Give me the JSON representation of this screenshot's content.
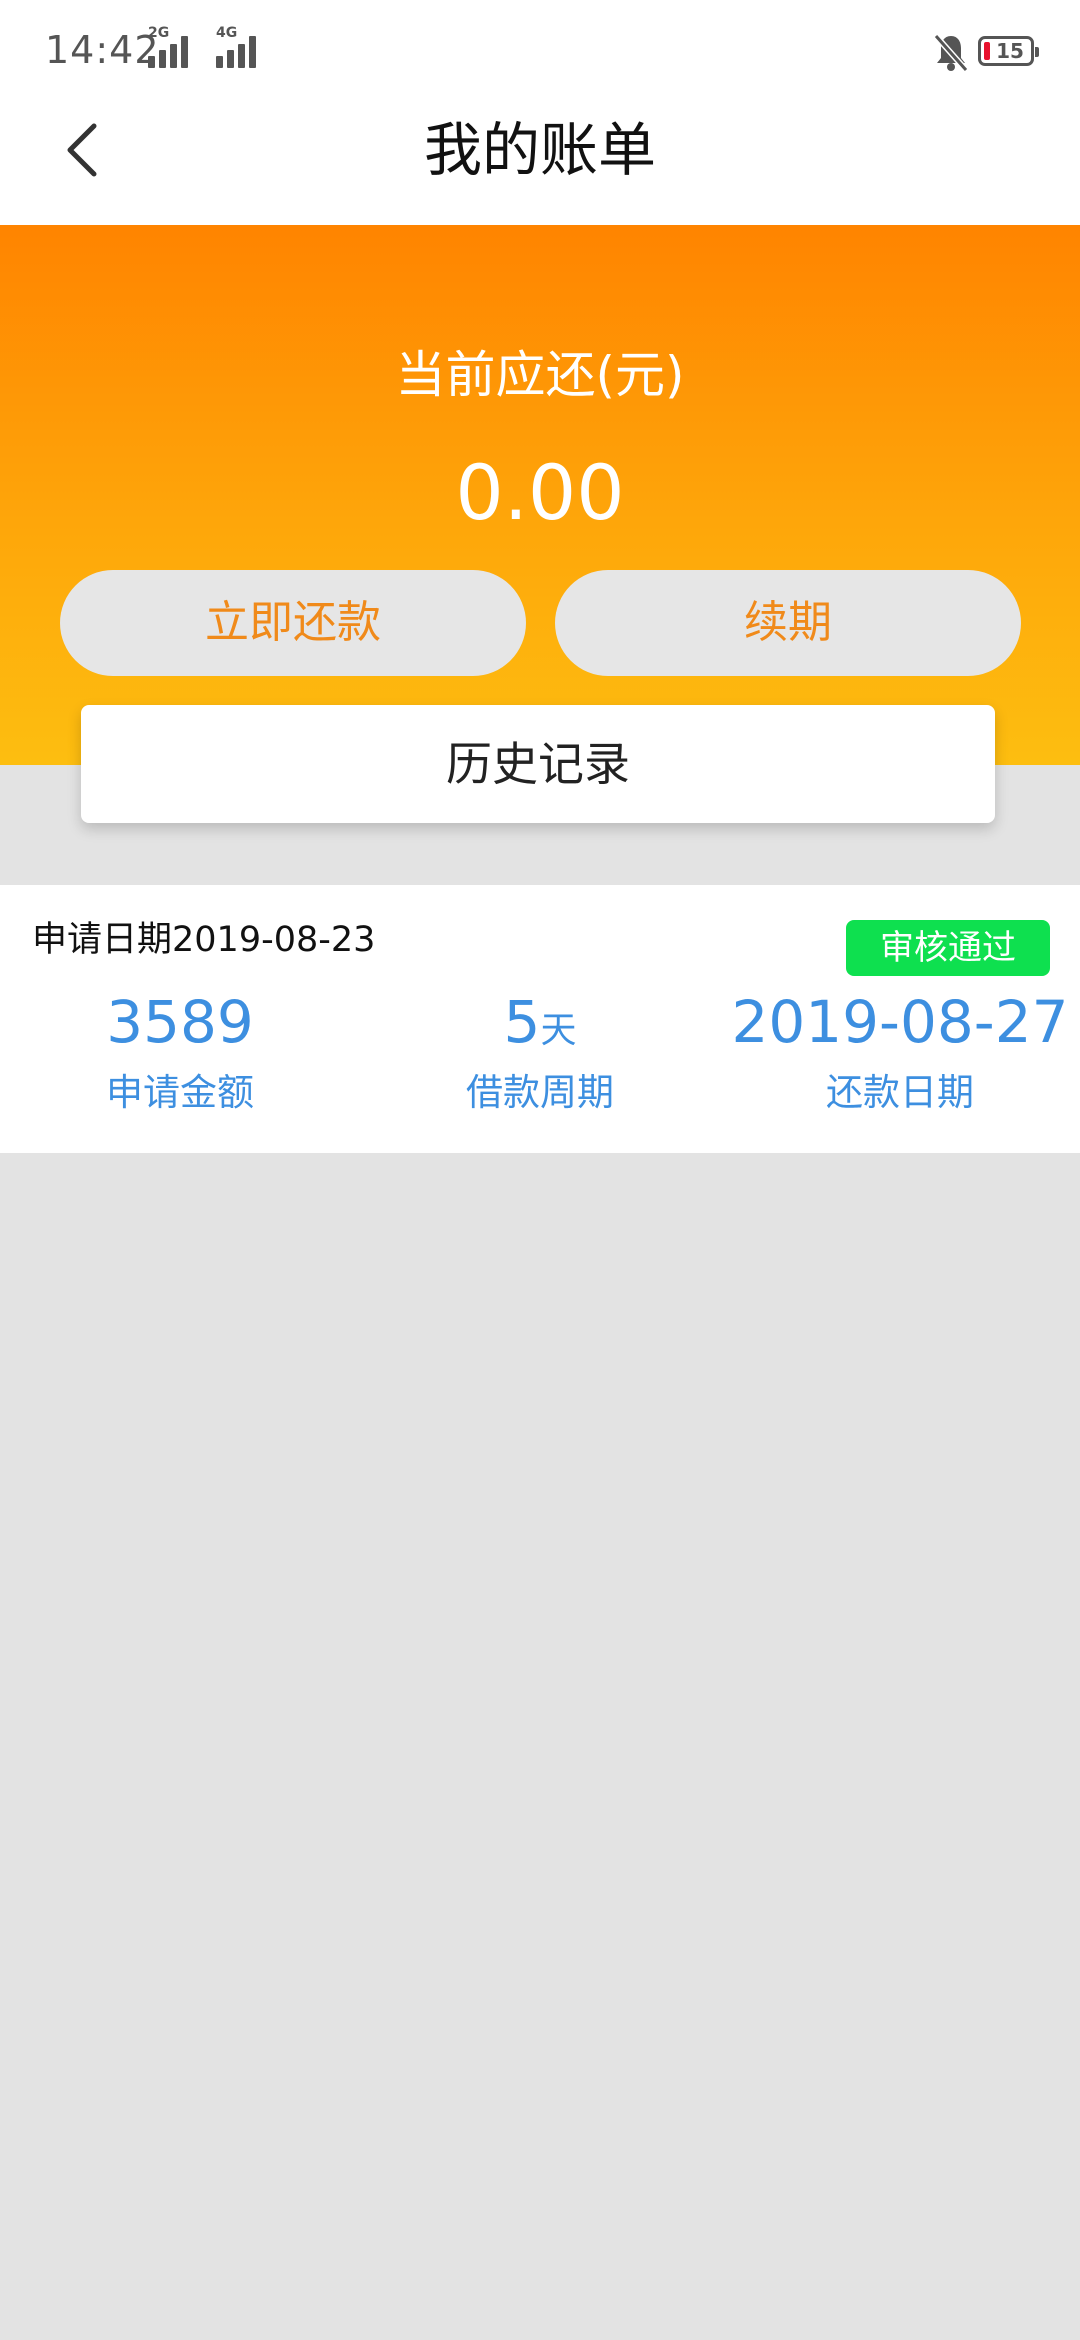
{
  "status_bar": {
    "time": "14:42",
    "network_1": "2G",
    "network_2": "4G",
    "battery": "15"
  },
  "header": {
    "title": "我的账单"
  },
  "summary": {
    "label": "当前应还(元)",
    "amount": "0.00",
    "repay_label": "立即还款",
    "renew_label": "续期",
    "history_label": "历史记录"
  },
  "record": {
    "apply_date_label": "申请日期",
    "apply_date": "2019-08-23",
    "status": "审核通过",
    "amount_value": "3589",
    "amount_label": "申请金额",
    "period_value": "5",
    "period_unit": "天",
    "period_label": "借款周期",
    "repay_date_value": "2019-08-27",
    "repay_date_label": "还款日期"
  },
  "colors": {
    "accent_orange": "#ff8400",
    "accent_yellow": "#fdbe10",
    "button_text": "#f08a1a",
    "stat_blue": "#3d8fe0",
    "badge_green": "#0ee04f"
  }
}
